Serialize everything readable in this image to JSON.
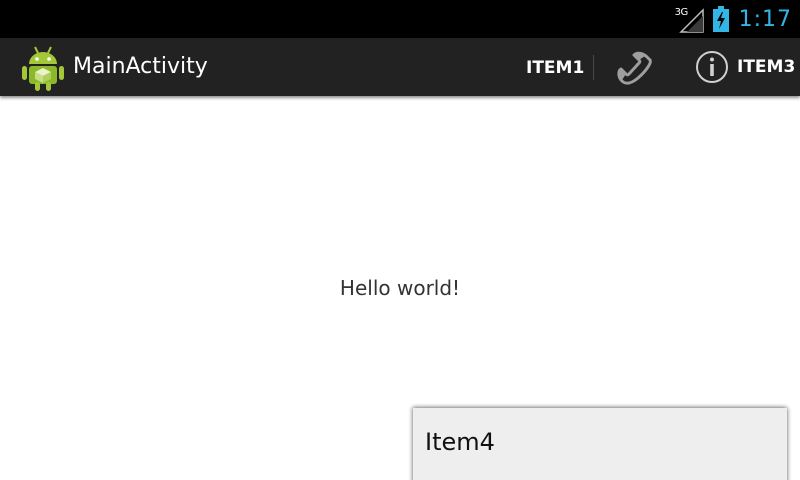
{
  "status_bar": {
    "network_type": "3G",
    "clock": "1:17",
    "accent_color": "#33b5e5",
    "signal_icon": "signal-strength-icon",
    "battery_icon": "battery-charging-icon"
  },
  "action_bar": {
    "app_icon": "android-robot-icon",
    "title": "MainActivity",
    "items": [
      {
        "label": "ITEM1"
      },
      {
        "icon": "phone-icon"
      },
      {
        "icon": "info-icon",
        "label": "ITEM3"
      }
    ]
  },
  "content": {
    "text": "Hello world!"
  },
  "overflow_menu": {
    "items": [
      {
        "label": "Item4"
      }
    ]
  }
}
